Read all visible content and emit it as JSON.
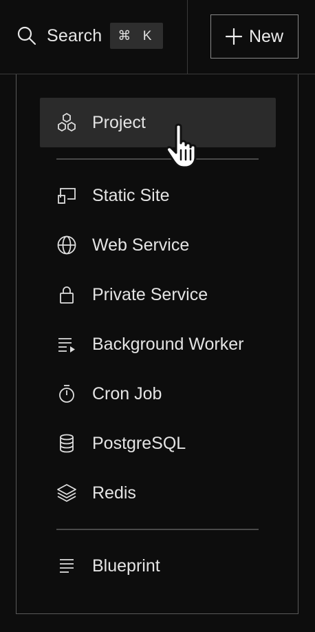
{
  "topbar": {
    "search_label": "Search",
    "search_shortcut": "⌘ K",
    "search_icon": "search-icon",
    "new_button_label": "New",
    "new_button_icon": "plus-icon"
  },
  "menu": {
    "primary": {
      "label": "Project",
      "icon": "project-icon",
      "state": "hovered"
    },
    "services": [
      {
        "label": "Static Site",
        "icon": "static-site-icon"
      },
      {
        "label": "Web Service",
        "icon": "globe-icon"
      },
      {
        "label": "Private Service",
        "icon": "lock-icon"
      },
      {
        "label": "Background Worker",
        "icon": "background-worker-icon"
      },
      {
        "label": "Cron Job",
        "icon": "stopwatch-icon"
      },
      {
        "label": "PostgreSQL",
        "icon": "database-icon"
      },
      {
        "label": "Redis",
        "icon": "layers-icon"
      }
    ],
    "footer": {
      "label": "Blueprint",
      "icon": "blueprint-icon"
    }
  },
  "colors": {
    "background": "#0d0d0d",
    "hover_background": "#2b2b2b",
    "border": "#5a5a5a",
    "text": "#e4e4e4"
  }
}
